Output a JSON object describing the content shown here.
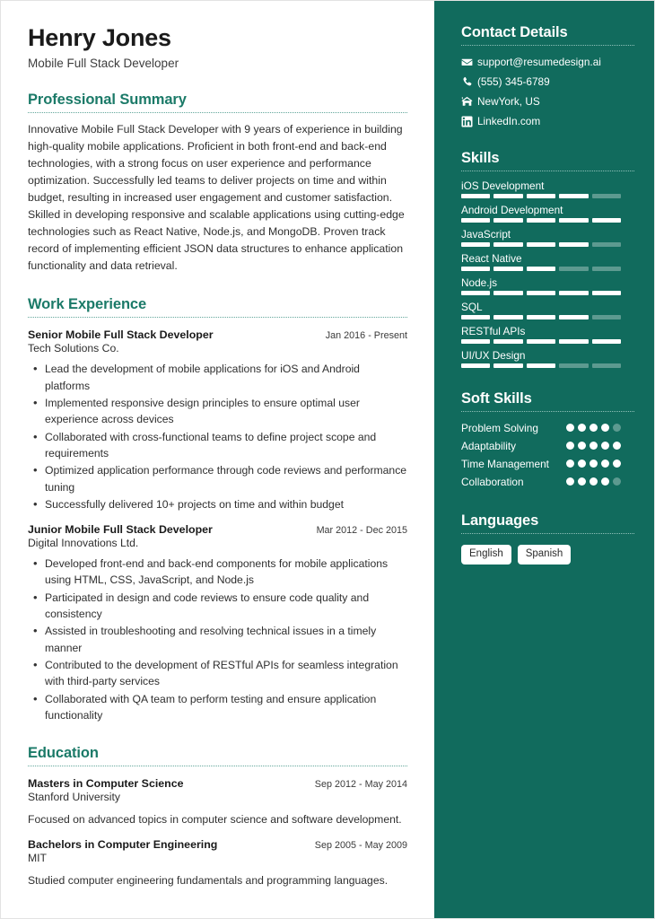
{
  "theme": {
    "sidebar_bg": "#116b5d",
    "heading_teal": "#1b7a68",
    "segment_on": "#ffffff",
    "segment_off": "#5d9a90"
  },
  "header": {
    "name": "Henry Jones",
    "job_title": "Mobile Full Stack Developer"
  },
  "summary": {
    "heading": "Professional Summary",
    "text": "Innovative Mobile Full Stack Developer with 9 years of experience in building high-quality mobile applications. Proficient in both front-end and back-end technologies, with a strong focus on user experience and performance optimization. Successfully led teams to deliver projects on time and within budget, resulting in increased user engagement and customer satisfaction. Skilled in developing responsive and scalable applications using cutting-edge technologies such as React Native, Node.js, and MongoDB. Proven track record of implementing efficient JSON data structures to enhance application functionality and data retrieval."
  },
  "work": {
    "heading": "Work Experience",
    "jobs": [
      {
        "title": "Senior Mobile Full Stack Developer",
        "date": "Jan 2016 - Present",
        "company": "Tech Solutions Co.",
        "bullets": [
          "Lead the development of mobile applications for iOS and Android platforms",
          "Implemented responsive design principles to ensure optimal user experience across devices",
          "Collaborated with cross-functional teams to define project scope and requirements",
          "Optimized application performance through code reviews and performance tuning",
          "Successfully delivered 10+ projects on time and within budget"
        ]
      },
      {
        "title": "Junior Mobile Full Stack Developer",
        "date": "Mar 2012 - Dec 2015",
        "company": "Digital Innovations Ltd.",
        "bullets": [
          "Developed front-end and back-end components for mobile applications using HTML, CSS, JavaScript, and Node.js",
          "Participated in design and code reviews to ensure code quality and consistency",
          "Assisted in troubleshooting and resolving technical issues in a timely manner",
          "Contributed to the development of RESTful APIs for seamless integration with third-party services",
          "Collaborated with QA team to perform testing and ensure application functionality"
        ]
      }
    ]
  },
  "education": {
    "heading": "Education",
    "items": [
      {
        "degree": "Masters in Computer Science",
        "date": "Sep 2012 - May 2014",
        "school": "Stanford University",
        "description": "Focused on advanced topics in computer science and software development."
      },
      {
        "degree": "Bachelors in Computer Engineering",
        "date": "Sep 2005 - May 2009",
        "school": "MIT",
        "description": "Studied computer engineering fundamentals and programming languages."
      }
    ]
  },
  "contact": {
    "heading": "Contact Details",
    "items": [
      {
        "icon": "envelope-icon",
        "value": "support@resumedesign.ai"
      },
      {
        "icon": "phone-icon",
        "value": "(555) 345-6789"
      },
      {
        "icon": "home-icon",
        "value": "NewYork, US"
      },
      {
        "icon": "linkedin-icon",
        "value": "LinkedIn.com"
      }
    ]
  },
  "skills": {
    "heading": "Skills",
    "max": 5,
    "items": [
      {
        "name": "iOS Development",
        "level": 4
      },
      {
        "name": "Android Development",
        "level": 5
      },
      {
        "name": "JavaScript",
        "level": 4
      },
      {
        "name": "React Native",
        "level": 3
      },
      {
        "name": "Node.js",
        "level": 5
      },
      {
        "name": "SQL",
        "level": 4
      },
      {
        "name": "RESTful APIs",
        "level": 5
      },
      {
        "name": "UI/UX Design",
        "level": 3
      }
    ]
  },
  "soft_skills": {
    "heading": "Soft Skills",
    "max": 5,
    "items": [
      {
        "name": "Problem Solving",
        "level": 4
      },
      {
        "name": "Adaptability",
        "level": 5
      },
      {
        "name": "Time Management",
        "level": 5
      },
      {
        "name": "Collaboration",
        "level": 4
      }
    ]
  },
  "languages": {
    "heading": "Languages",
    "items": [
      "English",
      "Spanish"
    ]
  }
}
